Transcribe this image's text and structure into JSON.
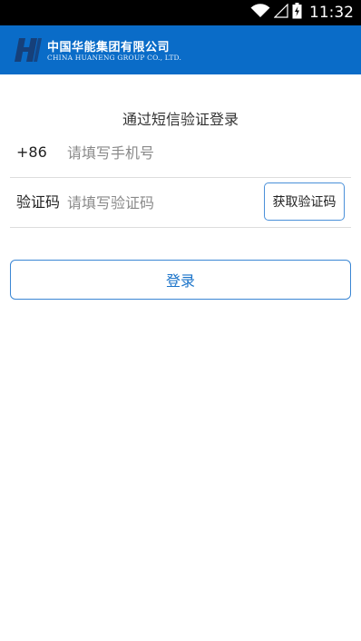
{
  "status_bar": {
    "time": "11:32",
    "icons": [
      "wifi-icon",
      "signal-icon",
      "battery-icon"
    ]
  },
  "header": {
    "brand_cn": "中国华能集团有限公司",
    "brand_en": "CHINA HUANENG GROUP CO., LTD.",
    "background_color": "#0a6cc8"
  },
  "form": {
    "title": "通过短信验证登录",
    "phone_prefix": "+86",
    "phone_placeholder": "请填写手机号",
    "phone_value": "",
    "code_label": "验证码",
    "code_placeholder": "请填写验证码",
    "code_value": "",
    "get_code_label": "获取验证码",
    "login_label": "登录",
    "accent_color": "#1a73c9"
  }
}
